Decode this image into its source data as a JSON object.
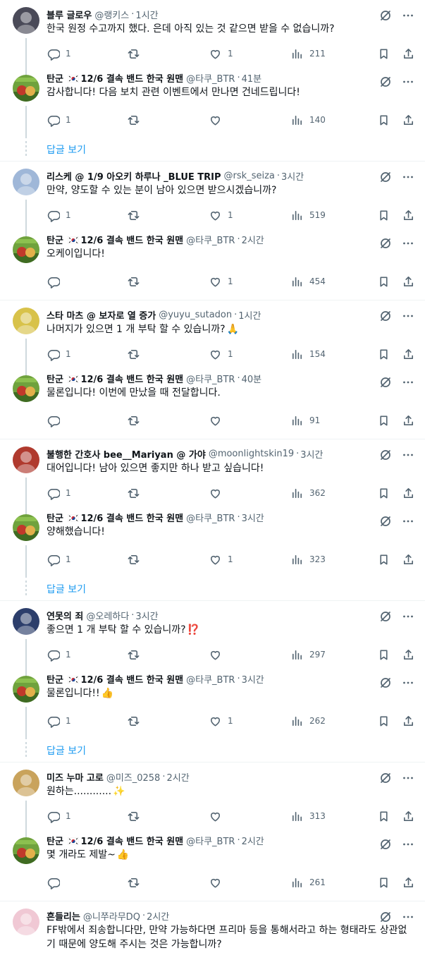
{
  "show_replies_label": "답글 보기",
  "threads": [
    {
      "show_replies": true,
      "tweets": [
        {
          "name": "블루 글로우",
          "flag": false,
          "handle": "@랭키스",
          "time": "1시간",
          "text": "한국 원정 수고까지 했다. 은데 아직 있는 것 같으면 받을 수 없습니까?",
          "emoji": "",
          "replies": "1",
          "retweets": "",
          "likes": "1",
          "views": "211",
          "avatar_color": "#4a4a58"
        },
        {
          "name": "탄군 🇰🇷12/6 결속 밴드 한국 원맨",
          "flag": true,
          "handle": "@타쿠_BTR",
          "time": "41분",
          "text": "감사합니다! 다음 보치 관련 이벤트에서 만나면 건네드립니다!",
          "emoji": "",
          "replies": "1",
          "retweets": "",
          "likes": "",
          "views": "140",
          "avatar_color": "#5c8a3a"
        }
      ]
    },
    {
      "show_replies": false,
      "tweets": [
        {
          "name": "리스케 @ 1/9 아오키 하루나 _BLUE TRIP",
          "flag": false,
          "handle": "@rsk_seiza",
          "time": "3시간",
          "text": "만약, 양도할 수 있는 분이 남아 있으면 받으시겠습니까?",
          "emoji": "",
          "replies": "1",
          "retweets": "",
          "likes": "1",
          "views": "519",
          "avatar_color": "#9fb7d8"
        },
        {
          "name": "탄군 🇰🇷12/6 결속 밴드 한국 원맨",
          "flag": true,
          "handle": "@타쿠_BTR",
          "time": "2시간",
          "text": "오케이입니다!",
          "emoji": "",
          "replies": "",
          "retweets": "",
          "likes": "1",
          "views": "454",
          "avatar_color": "#5c8a3a"
        }
      ]
    },
    {
      "show_replies": false,
      "tweets": [
        {
          "name": "스타 마츠 @ 보자로 열 증가",
          "flag": false,
          "handle": "@yuyu_sutadon",
          "time": "1시간",
          "text": "나머지가 있으면 1 개 부탁 할 수 있습니까?",
          "emoji": "🙏",
          "replies": "1",
          "retweets": "",
          "likes": "1",
          "views": "154",
          "avatar_color": "#d8c24a"
        },
        {
          "name": "탄군 🇰🇷12/6 결속 밴드 한국 원맨",
          "flag": true,
          "handle": "@타쿠_BTR",
          "time": "40분",
          "text": "물론입니다! 이번에 만났을 때 전달합니다.",
          "emoji": "",
          "replies": "",
          "retweets": "",
          "likes": "",
          "views": "91",
          "avatar_color": "#5c8a3a"
        }
      ]
    },
    {
      "show_replies": true,
      "tweets": [
        {
          "name": "불행한 간호사 bee__Mariyan @ 가야",
          "flag": false,
          "handle": "@moonlightskin19",
          "time": "3시간",
          "text": "대어입니다! 남아 있으면 좋지만 하나 받고 싶습니다!",
          "emoji": "",
          "replies": "1",
          "retweets": "",
          "likes": "",
          "views": "362",
          "avatar_color": "#b03a2e"
        },
        {
          "name": "탄군 🇰🇷12/6 결속 밴드 한국 원맨",
          "flag": true,
          "handle": "@타쿠_BTR",
          "time": "3시간",
          "text": "양해했습니다!",
          "emoji": "",
          "replies": "1",
          "retweets": "",
          "likes": "1",
          "views": "323",
          "avatar_color": "#5c8a3a"
        }
      ]
    },
    {
      "show_replies": true,
      "tweets": [
        {
          "name": "연못의 죄",
          "flag": false,
          "handle": "@오레하다",
          "time": "3시간",
          "text": "좋으면 1 개 부탁 할 수 있습니까?",
          "emoji": "⁉️",
          "replies": "1",
          "retweets": "",
          "likes": "",
          "views": "297",
          "avatar_color": "#2c3e6b"
        },
        {
          "name": "탄군 🇰🇷12/6 결속 밴드 한국 원맨",
          "flag": true,
          "handle": "@타쿠_BTR",
          "time": "3시간",
          "text": "물론입니다!!",
          "emoji": "👍",
          "replies": "1",
          "retweets": "",
          "likes": "1",
          "views": "262",
          "avatar_color": "#5c8a3a"
        }
      ]
    },
    {
      "show_replies": false,
      "tweets": [
        {
          "name": "미즈 누마 고로",
          "flag": false,
          "handle": "@미즈_0258",
          "time": "2시간",
          "text": "원하는............",
          "emoji": "✨",
          "replies": "1",
          "retweets": "",
          "likes": "",
          "views": "313",
          "avatar_color": "#c9a35c"
        },
        {
          "name": "탄군 🇰🇷12/6 결속 밴드 한국 원맨",
          "flag": true,
          "handle": "@타쿠_BTR",
          "time": "2시간",
          "text": "몇 개라도 제발~",
          "emoji": "👍",
          "replies": "",
          "retweets": "",
          "likes": "",
          "views": "261",
          "avatar_color": "#5c8a3a"
        }
      ]
    },
    {
      "show_replies": false,
      "tweets": [
        {
          "name": "흔들리는",
          "flag": false,
          "handle": "@니쭈라무DQ",
          "time": "2시간",
          "text": "FF밖에서 죄송합니다만, 만약 가능하다면 프리마 등을 통해서라고 하는 형태라도 상관없기 때문에 양도해 주시는 것은 가능합니까?",
          "emoji": "",
          "replies": "",
          "retweets": "",
          "likes": "",
          "views": "",
          "avatar_color": "#f0c8d4"
        }
      ]
    }
  ]
}
